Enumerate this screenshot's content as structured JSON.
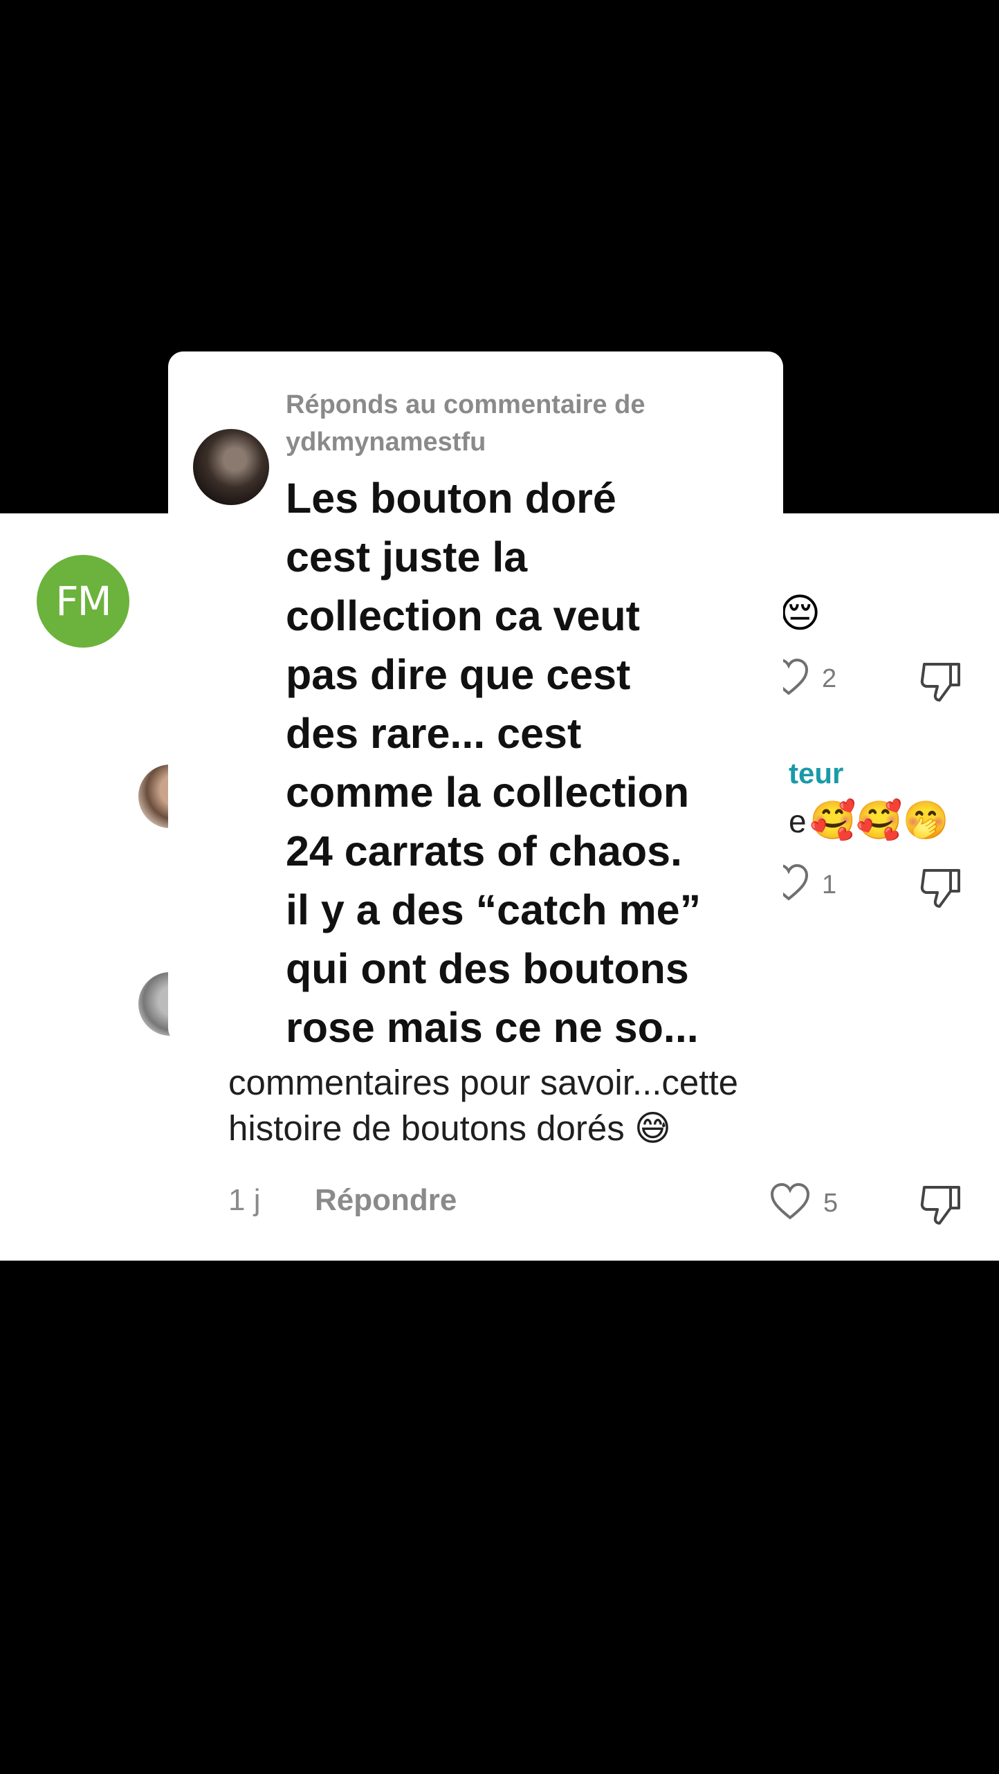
{
  "comment_1": {
    "avatar_initials": "FM",
    "emoji_fragment": "😔",
    "like_count": "2"
  },
  "comment_2": {
    "badge_fragment": "teur",
    "text_fragment": "e",
    "emoji_fragment": "🥰🥰🤭",
    "like_count": "1"
  },
  "comment_3": {
    "text_line_1": "commentaires pour savoir...cette",
    "text_line_2": "histoire de boutons dorés 😅",
    "time": "1 j",
    "reply_label": "Répondre",
    "like_count": "5"
  },
  "reply_card": {
    "header_line_1": "Réponds au commentaire de",
    "header_line_2": "ydkmynamestfu",
    "body_lines": [
      "Les bouton doré",
      "cest juste la",
      "collection ca veut",
      "pas dire que cest",
      "des rare... cest",
      "comme la collection",
      "24 carrats of chaos.",
      "il y a des “catch me”",
      "qui ont des boutons",
      "rose mais ce ne so..."
    ]
  },
  "icons": {
    "like": "heart-outline-icon",
    "dislike": "thumbs-down-icon"
  },
  "colors": {
    "background": "#000000",
    "panel": "#ffffff",
    "avatar_fm": "#6bb33c",
    "badge_teal": "#1a9aa8",
    "muted_text": "#8a8a8a"
  }
}
